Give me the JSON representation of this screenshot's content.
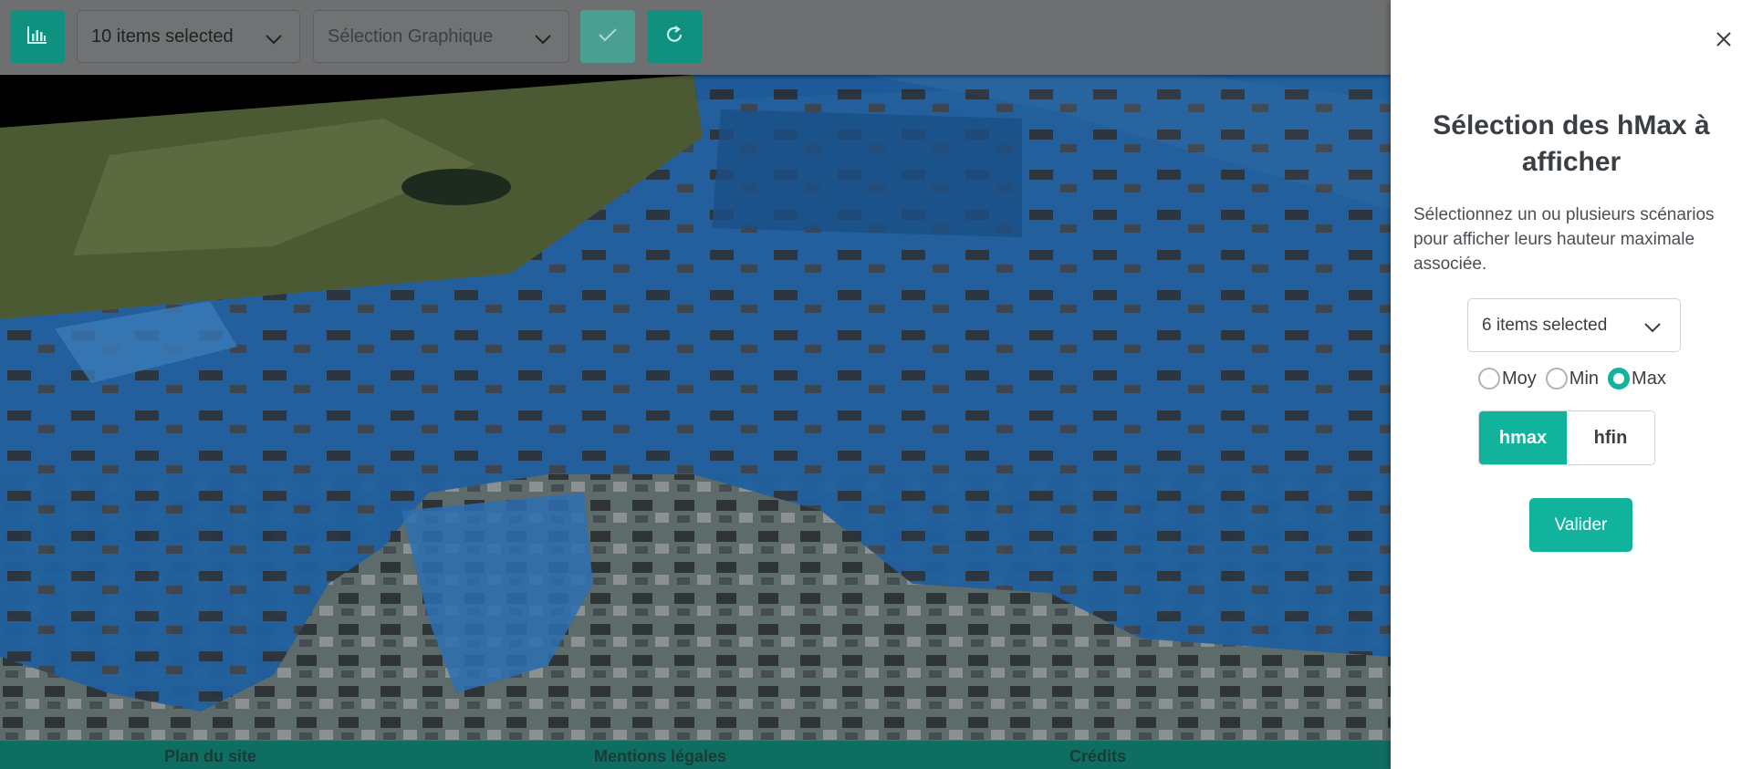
{
  "toolbar": {
    "chart_button_icon": "bar-chart-icon",
    "items_select": "10 items selected",
    "graph_select_placeholder": "Sélection Graphique",
    "confirm_icon": "check-icon",
    "refresh_icon": "refresh-icon"
  },
  "footer": {
    "links": [
      "Plan du site",
      "Mentions légales",
      "Crédits"
    ]
  },
  "panel": {
    "close_icon": "close-icon",
    "title": "Sélection des hMax à afficher",
    "description": "Sélectionnez un ou plusieurs scénarios pour afficher leurs hauteur maximale associée.",
    "scenario_select": "6 items selected",
    "radios": [
      {
        "label": "Moy",
        "checked": false
      },
      {
        "label": "Min",
        "checked": false
      },
      {
        "label": "Max",
        "checked": true
      }
    ],
    "segments": [
      {
        "label": "hmax",
        "active": true
      },
      {
        "label": "hfin",
        "active": false
      }
    ],
    "submit_label": "Valider"
  },
  "colors": {
    "accent": "#12b39d",
    "toolbar_button": "#10917f",
    "footer": "#0f6e62",
    "flood_overlay": "#2f7fd0"
  }
}
